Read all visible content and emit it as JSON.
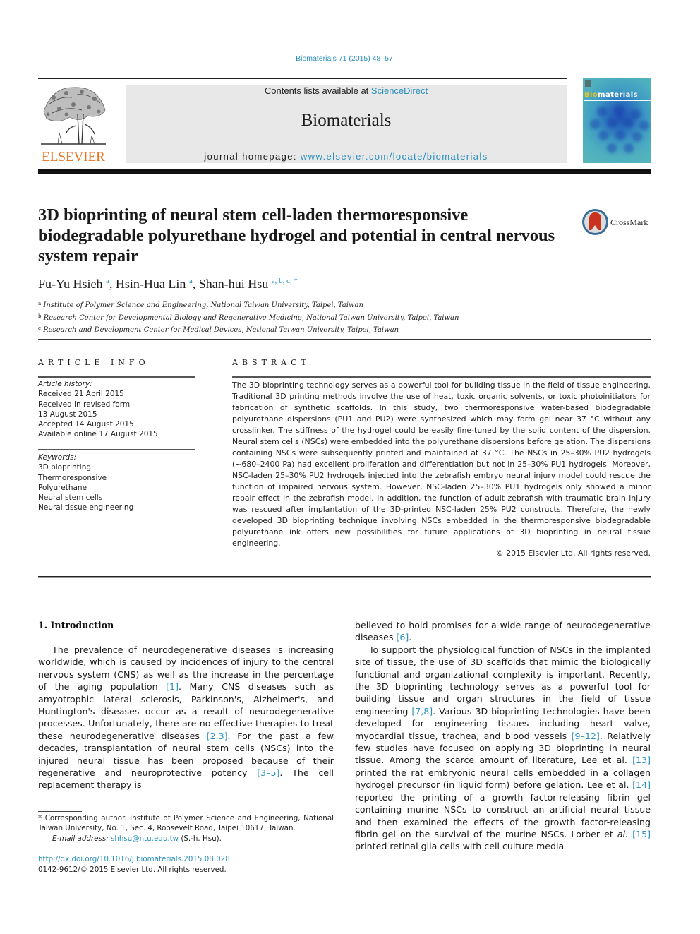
{
  "header": {
    "citation": "Biomaterials 71 (2015) 48–57",
    "contents_prefix": "Contents lists available at ",
    "contents_link": "ScienceDirect",
    "journal_title": "Biomaterials",
    "homepage_prefix": "journal homepage: ",
    "homepage_link": "www.elsevier.com/locate/biomaterials",
    "publisher_logo_text": "ELSEVIER",
    "cover_title_highlight": "Bio",
    "cover_title_rest": "materials",
    "crossmark_label": "CrossMark"
  },
  "article": {
    "title": "3D bioprinting of neural stem cell-laden thermoresponsive biodegradable polyurethane hydrogel and potential in central nervous system repair",
    "authors": [
      {
        "name": "Fu-Yu Hsieh",
        "affil": "a"
      },
      {
        "name": "Hsin-Hua Lin",
        "affil": "a"
      },
      {
        "name": "Shan-hui Hsu",
        "affil": "a, b, c, *"
      }
    ],
    "affiliations": [
      {
        "mark": "a",
        "text": "Institute of Polymer Science and Engineering, National Taiwan University, Taipei, Taiwan"
      },
      {
        "mark": "b",
        "text": "Research Center for Developmental Biology and Regenerative Medicine, National Taiwan University, Taipei, Taiwan"
      },
      {
        "mark": "c",
        "text": "Research and Development Center for Medical Devices, National Taiwan University, Taipei, Taiwan"
      }
    ]
  },
  "article_info": {
    "heading": "ARTICLE INFO",
    "history_label": "Article history:",
    "history": [
      "Received 21 April 2015",
      "Received in revised form",
      "13 August 2015",
      "Accepted 14 August 2015",
      "Available online 17 August 2015"
    ],
    "keywords_label": "Keywords:",
    "keywords": [
      "3D bioprinting",
      "Thermoresponsive",
      "Polyurethane",
      "Neural stem cells",
      "Neural tissue engineering"
    ]
  },
  "abstract": {
    "heading": "ABSTRACT",
    "text": "The 3D bioprinting technology serves as a powerful tool for building tissue in the field of tissue engineering. Traditional 3D printing methods involve the use of heat, toxic organic solvents, or toxic photoinitiators for fabrication of synthetic scaffolds. In this study, two thermoresponsive water-based biodegradable polyurethane dispersions (PU1 and PU2) were synthesized which may form gel near 37 °C without any crosslinker. The stiffness of the hydrogel could be easily fine-tuned by the solid content of the dispersion. Neural stem cells (NSCs) were embedded into the polyurethane dispersions before gelation. The dispersions containing NSCs were subsequently printed and maintained at 37 °C. The NSCs in 25–30% PU2 hydrogels (~680–2400 Pa) had excellent proliferation and differentiation but not in 25–30% PU1 hydrogels. Moreover, NSC-laden 25–30% PU2 hydrogels injected into the zebrafish embryo neural injury model could rescue the function of impaired nervous system. However, NSC-laden 25–30% PU1 hydrogels only showed a minor repair effect in the zebrafish model. In addition, the function of adult zebrafish with traumatic brain injury was rescued after implantation of the 3D-printed NSC-laden 25% PU2 constructs. Therefore, the newly developed 3D bioprinting technique involving NSCs embedded in the thermoresponsive biodegradable polyurethane ink offers new possibilities for future applications of 3D bioprinting in neural tissue engineering.",
    "copyright": "© 2015 Elsevier Ltd. All rights reserved."
  },
  "body": {
    "section_heading": "1.  Introduction",
    "left_col": [
      {
        "t": "The prevalence of neurodegenerative diseases is increasing worldwide, which is caused by incidences of injury to the central nervous system (CNS) as well as the increase in the percentage of the aging population "
      },
      {
        "ref": "[1]"
      },
      {
        "t": ". Many CNS diseases such as amyotrophic lateral sclerosis, Parkinson's, Alzheimer's, and Huntington's diseases occur as a result of neurodegenerative processes. Unfortunately, there are no effective therapies to treat these neurodegenerative diseases "
      },
      {
        "ref": "[2,3]"
      },
      {
        "t": ". For the past a few decades, transplantation of neural stem cells (NSCs) into the injured neural tissue has been proposed because of their regenerative and neuroprotective potency "
      },
      {
        "ref": "[3–5]"
      },
      {
        "t": ". The cell replacement therapy is"
      }
    ],
    "right_col_p1": [
      {
        "t": "believed to hold promises for a wide range of neurodegenerative diseases "
      },
      {
        "ref": "[6]"
      },
      {
        "t": "."
      }
    ],
    "right_col_p2": [
      {
        "t": "To support the physiological function of NSCs in the implanted site of tissue, the use of 3D scaffolds that mimic the biologically functional and organizational complexity is important. Recently, the 3D bioprinting technology serves as a powerful tool for building tissue and organ structures in the field of tissue engineering "
      },
      {
        "ref": "[7,8]"
      },
      {
        "t": ". Various 3D bioprinting technologies have been developed for engineering tissues including heart valve, myocardial tissue, trachea, and blood vessels "
      },
      {
        "ref": "[9–12]"
      },
      {
        "t": ". Relatively few studies have focused on applying 3D bioprinting in neural tissue. Among the scarce amount of literature, Lee et al. "
      },
      {
        "ref": "[13]"
      },
      {
        "t": " printed the rat embryonic neural cells embedded in a collagen hydrogel precursor (in liquid form) before gelation. Lee et al. "
      },
      {
        "ref": "[14]"
      },
      {
        "t": " reported the printing of a growth factor-releasing fibrin gel containing murine NSCs to construct an artificial neural tissue and then examined the effects of the growth factor-releasing fibrin gel on the survival of the murine NSCs. Lorber et "
      },
      {
        "em": "al."
      },
      {
        "t": " "
      },
      {
        "ref": "[15]"
      },
      {
        "t": " printed retinal glia cells with cell culture media"
      }
    ]
  },
  "footer": {
    "corresponding": "* Corresponding author. Institute of Polymer Science and Engineering, National Taiwan University, No. 1, Sec. 4, Roosevelt Road, Taipei 10617, Taiwan.",
    "email_label": "E-mail address: ",
    "email": "shhsu@ntu.edu.tw",
    "email_suffix": " (S.-h. Hsu).",
    "doi": "http://dx.doi.org/10.1016/j.biomaterials.2015.08.028",
    "issn": "0142-9612/© 2015 Elsevier Ltd. All rights reserved."
  },
  "colors": {
    "link": "#2a8fbd",
    "elsevier_orange": "#e9711c",
    "journal_box_bg": "#e8e8e8"
  }
}
